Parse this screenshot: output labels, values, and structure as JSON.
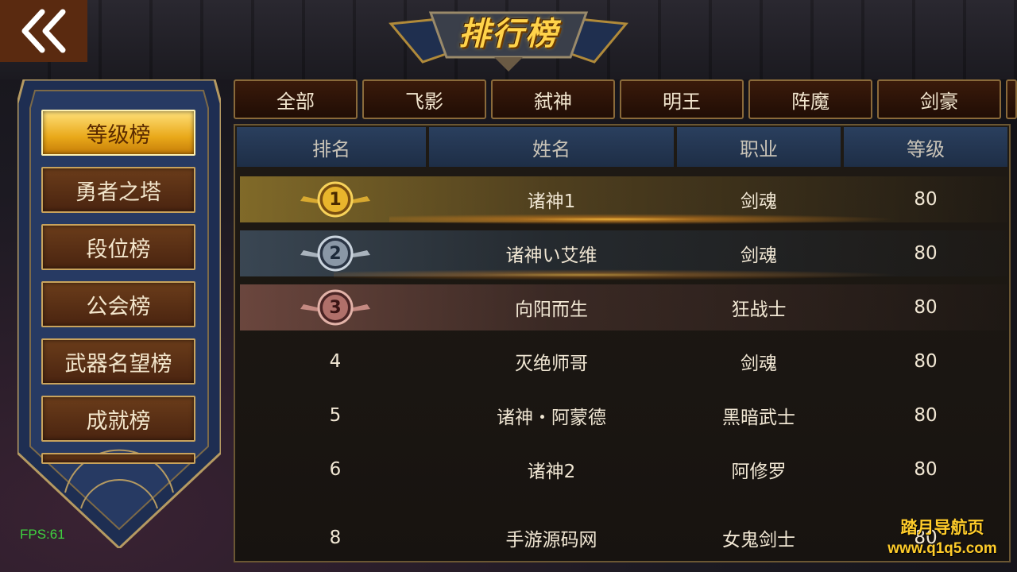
{
  "title": "排行榜",
  "back_button": {
    "icon": "double-chevron-left-icon"
  },
  "nav": {
    "items": [
      {
        "label": "等级榜",
        "active": true
      },
      {
        "label": "勇者之塔",
        "active": false
      },
      {
        "label": "段位榜",
        "active": false
      },
      {
        "label": "公会榜",
        "active": false
      },
      {
        "label": "武器名望榜",
        "active": false
      },
      {
        "label": "成就榜",
        "active": false
      }
    ]
  },
  "class_tabs": [
    "全部",
    "飞影",
    "弑神",
    "明王",
    "阵魔",
    "剑豪"
  ],
  "table": {
    "headers": [
      "排名",
      "姓名",
      "职业",
      "等级"
    ],
    "rows": [
      {
        "rank": "1",
        "name": "诸神1",
        "class": "剑魂",
        "level": "80",
        "medal": "gold-medal-icon"
      },
      {
        "rank": "2",
        "name": "诸神い艾维",
        "class": "剑魂",
        "level": "80",
        "medal": "silver-medal-icon"
      },
      {
        "rank": "3",
        "name": "向阳而生",
        "class": "狂战士",
        "level": "80",
        "medal": "bronze-medal-icon"
      },
      {
        "rank": "4",
        "name": "灭绝师哥",
        "class": "剑魂",
        "level": "80"
      },
      {
        "rank": "5",
        "name": "诸神・阿蒙德",
        "class": "黑暗武士",
        "level": "80"
      },
      {
        "rank": "6",
        "name": "诸神2",
        "class": "阿修罗",
        "level": "80"
      },
      {
        "rank": "8",
        "name": "手游源码网",
        "class": "女鬼剑士",
        "level": "80"
      }
    ]
  },
  "fps": "FPS:61",
  "watermark": {
    "line1": "踏月导航页",
    "line2": "www.q1q5.com"
  },
  "colors": {
    "gold": "#ffd34a",
    "active_tab": "#e9a91a",
    "header_blue": "#2a3f5e",
    "fps_green": "#3fd23f"
  }
}
